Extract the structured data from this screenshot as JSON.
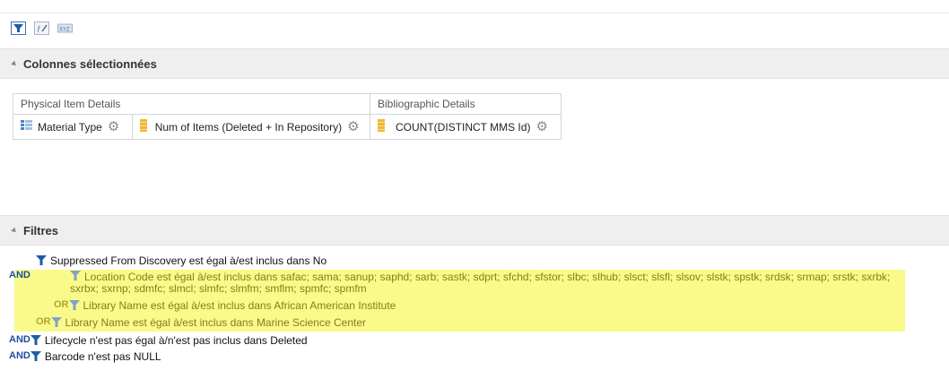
{
  "toolbar": {
    "icons": [
      "filter-icon",
      "edit-formula-icon",
      "sql-icon"
    ]
  },
  "sections": {
    "columns": {
      "title": "Colonnes sélectionnées"
    },
    "filters": {
      "title": "Filtres"
    }
  },
  "column_groups": [
    {
      "title": "Physical Item Details",
      "columns": [
        {
          "label": "Material Type",
          "icon": "attribute-icon"
        },
        {
          "label": "Num of Items (Deleted + In Repository)",
          "icon": "measure-icon"
        }
      ]
    },
    {
      "title": "Bibliographic Details",
      "columns": [
        {
          "label": "COUNT(DISTINCT MMS Id)",
          "icon": "measure-icon"
        }
      ]
    }
  ],
  "filters": {
    "f1": {
      "text": "Suppressed From Discovery est égal à/est inclus dans  No"
    },
    "f2": {
      "op": "AND",
      "text": "Location Code est égal à/est inclus dans  safac; sama; sanup; saphd; sarb; sastk; sdprt; sfchd; sfstor; slbc; slhub; slsct; slsfl; slsov; slstk; spstk; srdsk; srmap; srstk; sxrbk; sxrbx; sxrnp; sdmfc; slmcl; slmfc; slmfm; smflm; spmfc; spmfm"
    },
    "f3": {
      "op": "OR",
      "text": "Library Name est égal à/est inclus dans  African American Institute"
    },
    "f4": {
      "op": "OR",
      "text": "Library Name est égal à/est inclus dans  Marine Science Center"
    },
    "f5": {
      "op": "AND",
      "text": "Lifecycle n'est pas égal à/n'est pas inclus dans  Deleted"
    },
    "f6": {
      "op": "AND",
      "text": "Barcode n'est pas NULL"
    }
  },
  "colors": {
    "accent": "#1e4f9e",
    "highlight": "#f9fa8a",
    "gear": "#8a8a8a",
    "measure": "#f2b632",
    "attribute": "#4a86c5"
  }
}
